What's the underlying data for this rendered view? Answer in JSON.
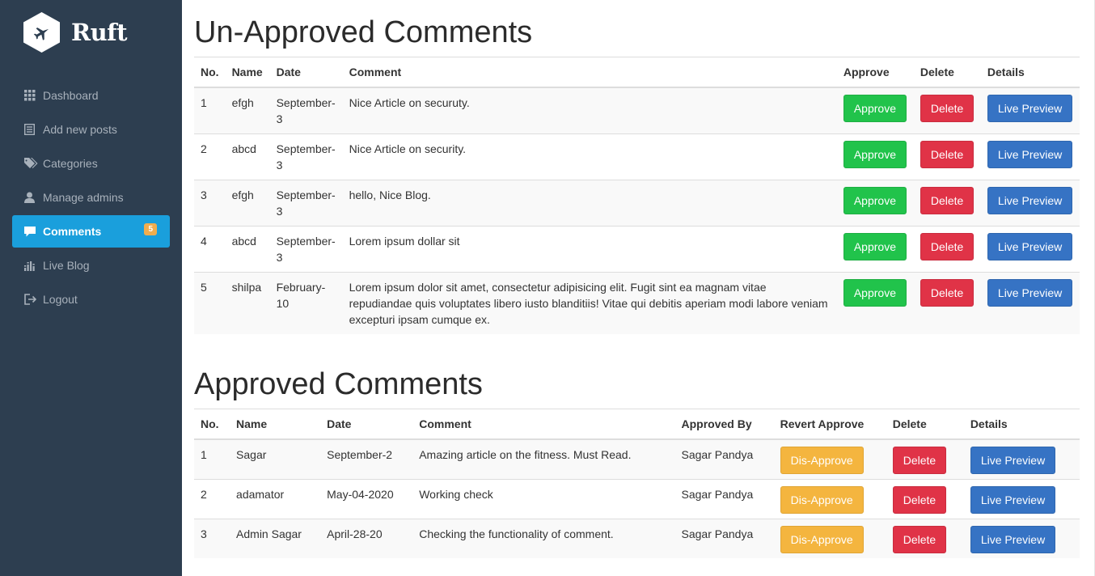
{
  "brand": {
    "name": "Ruft"
  },
  "sidebar": {
    "items": [
      {
        "label": "Dashboard",
        "icon": "grid-icon"
      },
      {
        "label": "Add new posts",
        "icon": "list-icon"
      },
      {
        "label": "Categories",
        "icon": "tags-icon"
      },
      {
        "label": "Manage admins",
        "icon": "user-icon"
      },
      {
        "label": "Comments",
        "icon": "comment-icon",
        "active": true,
        "badge": "5"
      },
      {
        "label": "Live Blog",
        "icon": "bars-icon"
      },
      {
        "label": "Logout",
        "icon": "logout-icon"
      }
    ]
  },
  "unapproved": {
    "title": "Un-Approved Comments",
    "headers": [
      "No.",
      "Name",
      "Date",
      "Comment",
      "Approve",
      "Delete",
      "Details"
    ],
    "rows": [
      {
        "no": "1",
        "name": "efgh",
        "date": "September-3",
        "comment": "Nice Article on securuty."
      },
      {
        "no": "2",
        "name": "abcd",
        "date": "September-3",
        "comment": "Nice Article on security."
      },
      {
        "no": "3",
        "name": "efgh",
        "date": "September-3",
        "comment": "hello, Nice Blog."
      },
      {
        "no": "4",
        "name": "abcd",
        "date": "September-3",
        "comment": "Lorem ipsum dollar sit"
      },
      {
        "no": "5",
        "name": "shilpa",
        "date": "February-10",
        "comment": "Lorem ipsum dolor sit amet, consectetur adipisicing elit. Fugit sint ea magnam vitae repudiandae quis voluptates libero iusto blanditiis! Vitae qui debitis aperiam modi labore veniam excepturi ipsam cumque ex."
      }
    ],
    "approve_label": "Approve",
    "delete_label": "Delete",
    "preview_label": "Live Preview"
  },
  "approved": {
    "title": "Approved Comments",
    "headers": [
      "No.",
      "Name",
      "Date",
      "Comment",
      "Approved By",
      "Revert Approve",
      "Delete",
      "Details"
    ],
    "rows": [
      {
        "no": "1",
        "name": "Sagar",
        "date": "September-2",
        "comment": "Amazing article on the fitness. Must Read.",
        "approved_by": "Sagar Pandya"
      },
      {
        "no": "2",
        "name": "adamator",
        "date": "May-04-2020",
        "comment": "Working check",
        "approved_by": "Sagar Pandya"
      },
      {
        "no": "3",
        "name": "Admin Sagar",
        "date": "April-28-20",
        "comment": "Checking the functionality of comment.",
        "approved_by": "Sagar Pandya"
      }
    ],
    "disapprove_label": "Dis-Approve",
    "delete_label": "Delete",
    "preview_label": "Live Preview"
  },
  "colors": {
    "sidebar_bg": "#2d3e50",
    "active_item": "#1a9fdc",
    "approve": "#21c34b",
    "delete": "#e03347",
    "preview": "#3673c4",
    "disapprove": "#f4b53f",
    "badge": "#f0ad4e"
  }
}
